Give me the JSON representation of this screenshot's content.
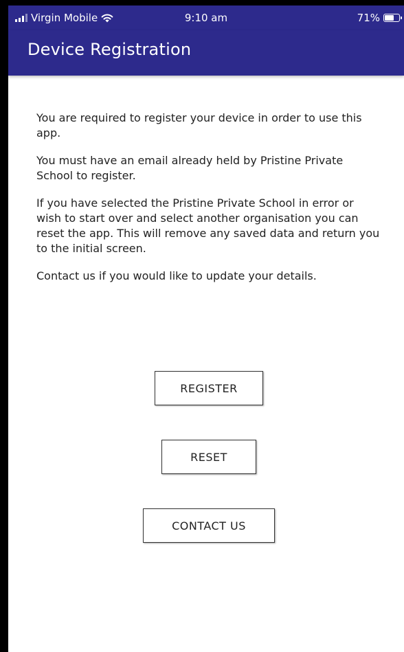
{
  "status_bar": {
    "carrier": "Virgin Mobile",
    "time": "9:10 am",
    "battery": "71%",
    "battery_level": 0.71,
    "icons": [
      "signal-icon",
      "wifi-icon",
      "battery-icon"
    ]
  },
  "header": {
    "title": "Device Registration",
    "background_color": "#2d2a8c"
  },
  "content": {
    "paragraphs": [
      "You are required to register your device in order to use this app.",
      "You must have an email already held by Pristine Private School to register.",
      "If you have selected the Pristine Private School in error or wish to start over and select another organisation you can reset the app.  This will remove any saved data and return  you to the initial screen.",
      "Contact us if you would like to update your details."
    ]
  },
  "buttons": {
    "register": "REGISTER",
    "reset": "RESET",
    "contact": "CONTACT US"
  }
}
